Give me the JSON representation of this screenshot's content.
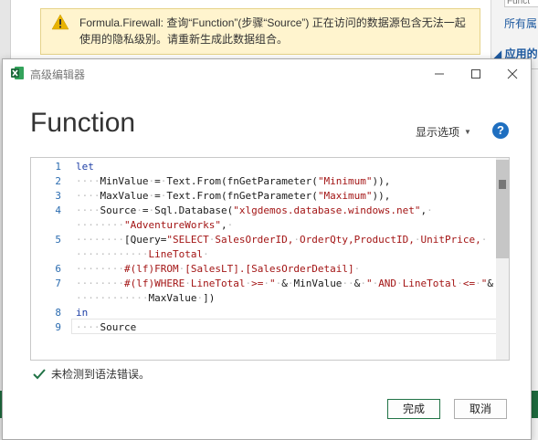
{
  "background": {
    "warning": {
      "icon": "warning-icon",
      "text": "Formula.Firewall: 查询“Function”(步骤“Source”) 正在访问的数据源包含无法一起使用的隐私级别。请重新生成此数据组合。"
    },
    "right_panel": {
      "search_value": "Funct",
      "all_properties_link": "所有属",
      "applied_steps_header": "◢ 应用的"
    }
  },
  "dialog": {
    "title": "高级编辑器",
    "heading": "Function",
    "display_options_label": "显示选项",
    "help_label": "?",
    "status_text": "未检测到语法错误。",
    "ok_label": "完成",
    "cancel_label": "取消"
  },
  "editor": {
    "line_numbers": [
      "1",
      "2",
      "3",
      "4",
      "",
      "5",
      "",
      "6",
      "7",
      "",
      "8",
      "9"
    ]
  },
  "colors": {
    "warning_bg": "#fff4ce",
    "excel_green": "#217346",
    "keyword": "#1e3fa6",
    "string": "#a31515",
    "line_number": "#2b6cb0",
    "help_blue": "#1f6fc0"
  }
}
